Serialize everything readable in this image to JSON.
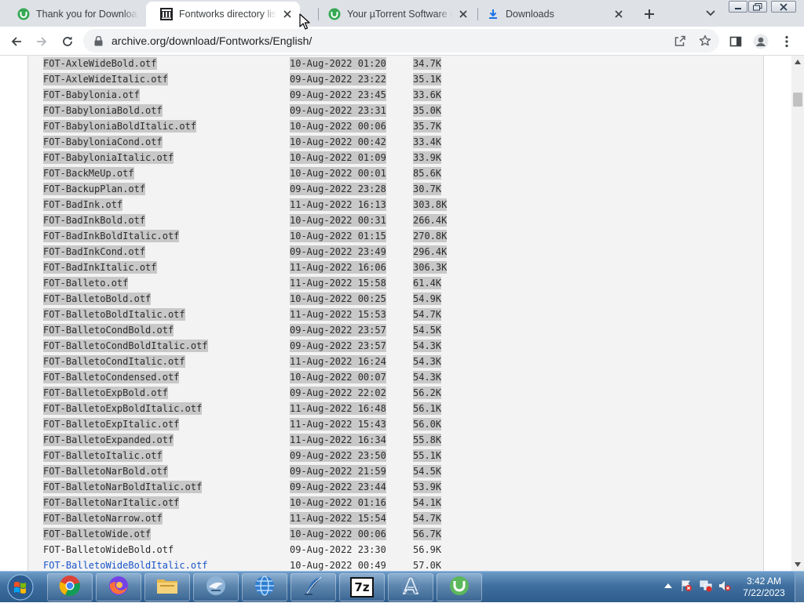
{
  "tabs": [
    {
      "title": "Thank you for Downloading",
      "icon": "utorrent-icon",
      "active": false
    },
    {
      "title": "Fontworks directory listing",
      "icon": "archive-org-icon",
      "active": true
    },
    {
      "title": "Your µTorrent Software is",
      "icon": "utorrent-icon",
      "active": false
    },
    {
      "title": "Downloads",
      "icon": "download-icon",
      "active": false
    }
  ],
  "address_bar": {
    "url": "archive.org/download/Fontworks/English/"
  },
  "files": [
    {
      "name": "FOT-AxleWideBold.otf",
      "date": "10-Aug-2022 01:20",
      "size": "34.7K"
    },
    {
      "name": "FOT-AxleWideItalic.otf",
      "date": "09-Aug-2022 23:22",
      "size": "35.1K"
    },
    {
      "name": "FOT-Babylonia.otf",
      "date": "09-Aug-2022 23:45",
      "size": "33.6K"
    },
    {
      "name": "FOT-BabyloniaBold.otf",
      "date": "09-Aug-2022 23:31",
      "size": "35.0K"
    },
    {
      "name": "FOT-BabyloniaBoldItalic.otf",
      "date": "10-Aug-2022 00:06",
      "size": "35.7K"
    },
    {
      "name": "FOT-BabyloniaCond.otf",
      "date": "10-Aug-2022 00:42",
      "size": "33.4K"
    },
    {
      "name": "FOT-BabyloniaItalic.otf",
      "date": "10-Aug-2022 01:09",
      "size": "33.9K"
    },
    {
      "name": "FOT-BackMeUp.otf",
      "date": "10-Aug-2022 00:01",
      "size": "85.6K"
    },
    {
      "name": "FOT-BackupPlan.otf",
      "date": "09-Aug-2022 23:28",
      "size": "30.7K"
    },
    {
      "name": "FOT-BadInk.otf",
      "date": "11-Aug-2022 16:13",
      "size": "303.8K"
    },
    {
      "name": "FOT-BadInkBold.otf",
      "date": "10-Aug-2022 00:31",
      "size": "266.4K"
    },
    {
      "name": "FOT-BadInkBoldItalic.otf",
      "date": "10-Aug-2022 01:15",
      "size": "270.8K"
    },
    {
      "name": "FOT-BadInkCond.otf",
      "date": "09-Aug-2022 23:49",
      "size": "296.4K"
    },
    {
      "name": "FOT-BadInkItalic.otf",
      "date": "11-Aug-2022 16:06",
      "size": "306.3K"
    },
    {
      "name": "FOT-Balleto.otf",
      "date": "11-Aug-2022 15:58",
      "size": "61.4K"
    },
    {
      "name": "FOT-BalletoBold.otf",
      "date": "10-Aug-2022 00:25",
      "size": "54.9K"
    },
    {
      "name": "FOT-BalletoBoldItalic.otf",
      "date": "11-Aug-2022 15:53",
      "size": "54.7K"
    },
    {
      "name": "FOT-BalletoCondBold.otf",
      "date": "09-Aug-2022 23:57",
      "size": "54.5K"
    },
    {
      "name": "FOT-BalletoCondBoldItalic.otf",
      "date": "09-Aug-2022 23:57",
      "size": "54.3K"
    },
    {
      "name": "FOT-BalletoCondItalic.otf",
      "date": "11-Aug-2022 16:24",
      "size": "54.3K"
    },
    {
      "name": "FOT-BalletoCondensed.otf",
      "date": "10-Aug-2022 00:07",
      "size": "54.3K"
    },
    {
      "name": "FOT-BalletoExpBold.otf",
      "date": "09-Aug-2022 22:02",
      "size": "56.2K"
    },
    {
      "name": "FOT-BalletoExpBoldItalic.otf",
      "date": "11-Aug-2022 16:48",
      "size": "56.1K"
    },
    {
      "name": "FOT-BalletoExpItalic.otf",
      "date": "11-Aug-2022 15:43",
      "size": "56.0K"
    },
    {
      "name": "FOT-BalletoExpanded.otf",
      "date": "11-Aug-2022 16:34",
      "size": "55.8K"
    },
    {
      "name": "FOT-BalletoItalic.otf",
      "date": "09-Aug-2022 23:50",
      "size": "55.1K"
    },
    {
      "name": "FOT-BalletoNarBold.otf",
      "date": "09-Aug-2022 21:59",
      "size": "54.5K"
    },
    {
      "name": "FOT-BalletoNarBoldItalic.otf",
      "date": "09-Aug-2022 23:44",
      "size": "53.9K"
    },
    {
      "name": "FOT-BalletoNarItalic.otf",
      "date": "10-Aug-2022 01:16",
      "size": "54.1K"
    },
    {
      "name": "FOT-BalletoNarrow.otf",
      "date": "11-Aug-2022 15:54",
      "size": "54.7K"
    },
    {
      "name": "FOT-BalletoWide.otf",
      "date": "10-Aug-2022 00:06",
      "size": "56.7K"
    },
    {
      "name": "FOT-BalletoWideBold.otf",
      "date": "09-Aug-2022 23:30",
      "size": "56.9K"
    },
    {
      "name": "FOT-BalletoWideBoldItalic.otf",
      "date": "10-Aug-2022 00:49",
      "size": "57.0K"
    }
  ],
  "taskbar": {
    "apps": [
      "chrome-icon",
      "firefox-icon",
      "file-explorer-icon",
      "thunderbird-icon",
      "network-globe-icon",
      "quill-icon",
      "7zip-icon",
      "font-tool-icon",
      "utorrent-icon"
    ],
    "sevenzip_label": "7z",
    "clock_time": "3:42 AM",
    "clock_date": "7/22/2023"
  },
  "colors": {
    "selection": "#c8c8c8",
    "link": "#1a55c9",
    "taskbar": "#3f6f9f"
  }
}
